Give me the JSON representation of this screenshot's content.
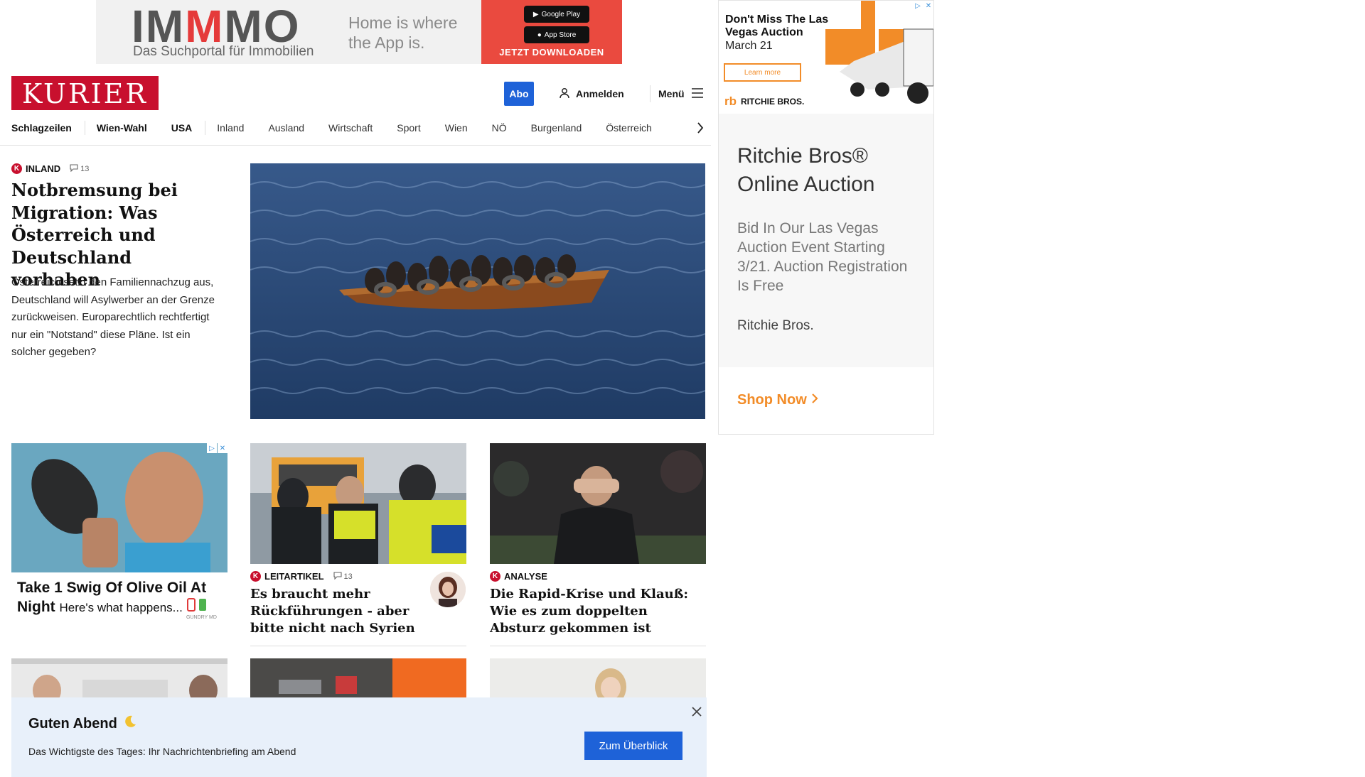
{
  "top_ad": {
    "logo_text_a": "IM",
    "logo_text_m": "M",
    "logo_text_b": "MO",
    "logo_sub": "Das Suchportal für Immobilien",
    "tagline": "Home is where the App is.",
    "google_play": "Google Play",
    "app_store": "App Store",
    "cta": "JETZT DOWNLOADEN"
  },
  "header": {
    "logo": "KURIER",
    "abo": "Abo",
    "login": "Anmelden",
    "menu": "Menü"
  },
  "nav": {
    "items": [
      "Schlagzeilen",
      "Wien-Wahl",
      "USA",
      "Inland",
      "Ausland",
      "Wirtschaft",
      "Sport",
      "Wien",
      "NÖ",
      "Burgenland",
      "Österreich"
    ]
  },
  "lead": {
    "kicker": "INLAND",
    "comments": "13",
    "title": "Notbremsung bei Migration: Was Österreich und Deutschland vorhaben",
    "teaser": "Österreich setzt den Familiennachzug aus, Deutschland will Asylwerber an der Grenze zurückweisen. Europarechtlich rechtfertigt nur ein \"Notstand\" diese Pläne. Ist ein solcher gegeben?"
  },
  "olive_ad": {
    "headline": "Take 1 Swig Of Olive Oil At Night",
    "sub": "Here's what happens...",
    "brand": "GUNDRY MD"
  },
  "cards": [
    {
      "kicker": "LEITARTIKEL",
      "comments": "13",
      "title": "Es braucht mehr Rückführungen - aber bitte nicht nach Syrien"
    },
    {
      "kicker": "ANALYSE",
      "title": "Die Rapid-Krise und Klauß: Wie es zum doppelten Absturz gekommen ist"
    }
  ],
  "right_ad": {
    "dont_miss": "Don't Miss The Las Vegas Auction",
    "date": "March 21",
    "learn_more": "Learn more",
    "small_brand": "RITCHIE BROS.",
    "title": "Ritchie Bros® Online Auction",
    "desc": "Bid In Our Las Vegas Auction Event Starting 3/21. Auction Registration Is Free",
    "brand": "Ritchie Bros.",
    "cta": "Shop Now"
  },
  "briefing": {
    "title": "Guten Abend",
    "subtitle": "Das Wichtigste des Tages: Ihr Nachrichtenbriefing am Abend",
    "button": "Zum Überblick"
  },
  "colors": {
    "brand_red": "#c8102e",
    "accent_blue": "#1e62d8",
    "ad_orange": "#f28c28"
  }
}
